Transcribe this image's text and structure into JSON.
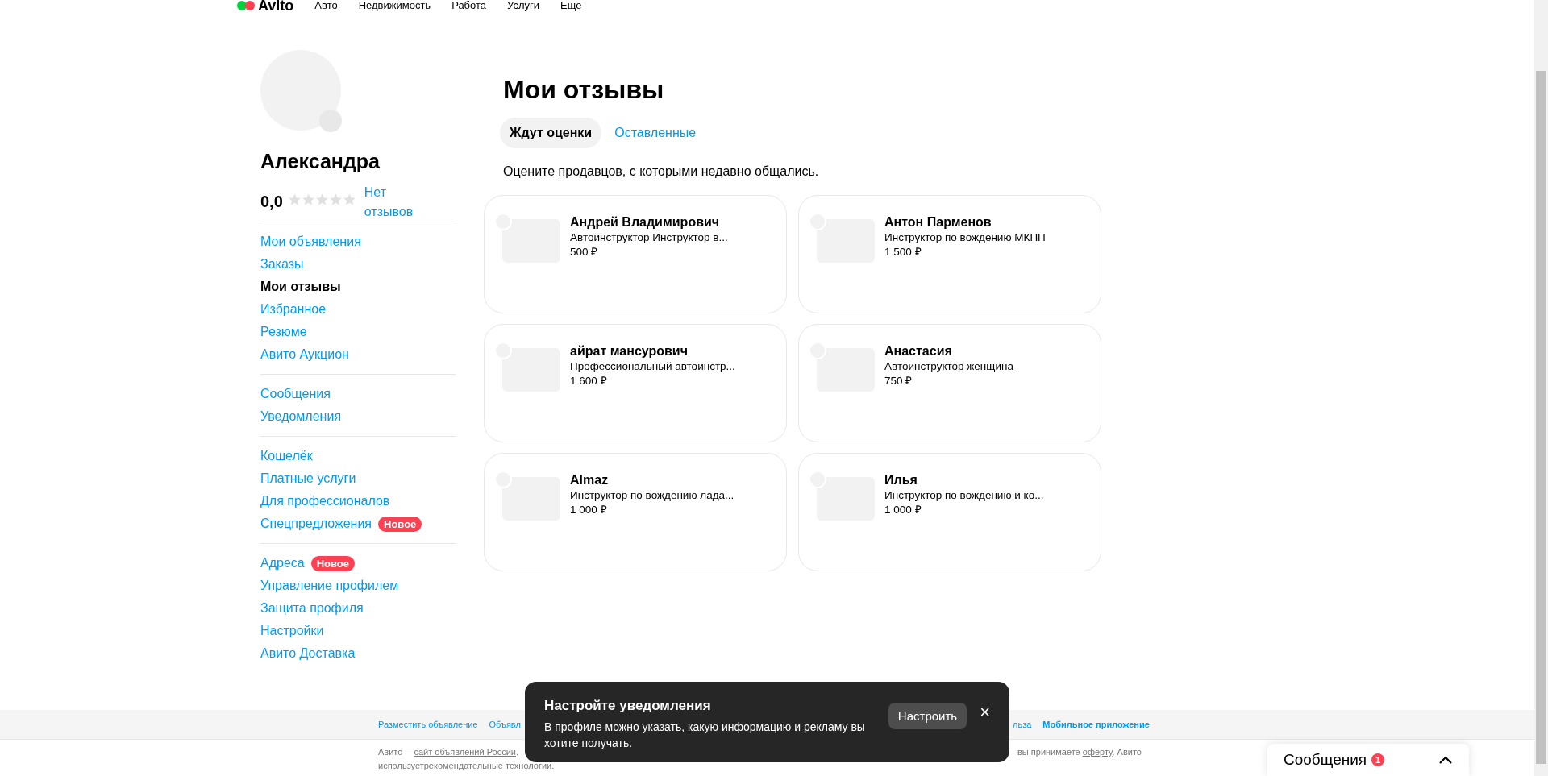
{
  "header": {
    "logo": "Avito",
    "nav": [
      "Авто",
      "Недвижимость",
      "Работа",
      "Услуги",
      "Еще"
    ]
  },
  "profile": {
    "name": "Александра",
    "rating": "0,0",
    "stars": 0,
    "reviews_link": "Нет отзывов"
  },
  "sidebar": {
    "groups": [
      [
        {
          "label": "Мои объявления",
          "selected": false
        },
        {
          "label": "Заказы",
          "selected": false
        },
        {
          "label": "Мои отзывы",
          "selected": true
        },
        {
          "label": "Избранное",
          "selected": false
        },
        {
          "label": "Резюме",
          "selected": false
        },
        {
          "label": "Авито Аукцион",
          "selected": false
        }
      ],
      [
        {
          "label": "Сообщения",
          "selected": false
        },
        {
          "label": "Уведомления",
          "selected": false
        }
      ],
      [
        {
          "label": "Кошелёк",
          "selected": false
        },
        {
          "label": "Платные услуги",
          "selected": false
        },
        {
          "label": "Для профессионалов",
          "selected": false
        },
        {
          "label": "Спецпредложения",
          "selected": false,
          "badge": "Новое"
        }
      ],
      [
        {
          "label": "Адреса",
          "selected": false,
          "badge": "Новое"
        },
        {
          "label": "Управление профилем",
          "selected": false
        },
        {
          "label": "Защита профиля",
          "selected": false
        },
        {
          "label": "Настройки",
          "selected": false
        },
        {
          "label": "Авито Доставка",
          "selected": false
        }
      ]
    ]
  },
  "page_title": "Мои отзывы",
  "tabs": [
    {
      "label": "Ждут оценки",
      "selected": true
    },
    {
      "label": "Оставленные",
      "selected": false
    }
  ],
  "hint": "Оцените продавцов, с которыми недавно общались.",
  "sellers": [
    {
      "name": "Андрей Владимирович",
      "listing": "Автоинструктор Инструктор в...",
      "price": "500 ₽"
    },
    {
      "name": "Антон Парменов",
      "listing": "Инструктор по вождению МКПП",
      "price": "1 500 ₽"
    },
    {
      "name": "айрат мансурович",
      "listing": "Профессиональный автоинстр...",
      "price": "1 600 ₽"
    },
    {
      "name": "Анастасия",
      "listing": "Автоинструктор женщина",
      "price": "750 ₽"
    },
    {
      "name": "Almaz",
      "listing": "Инструктор по вождению лада...",
      "price": "1 000 ₽"
    },
    {
      "name": "Илья",
      "listing": "Инструктор по вождению и ко...",
      "price": "1 000 ₽"
    }
  ],
  "footer": {
    "links_left": [
      "Разместить объявление",
      "Объявл"
    ],
    "links_right": [
      "льза",
      "Мобильное приложение"
    ],
    "line1_left": "Авито — ",
    "line1_link": "сайт объявлений России",
    "line1_end": ".",
    "line1_right": "вы принимаете ",
    "line1_right_link": "оферту",
    "line1_right_end": ". Авито",
    "line2": "использует ",
    "line2_link": "рекомендательные технологии",
    "line2_end": "."
  },
  "toast": {
    "title": "Настройте уведомления",
    "text": "В профиле можно указать, какую информацию и рекламу вы хотите получать.",
    "button": "Настроить",
    "close": "×"
  },
  "messages_widget": {
    "label": "Сообщения",
    "count": "1"
  }
}
